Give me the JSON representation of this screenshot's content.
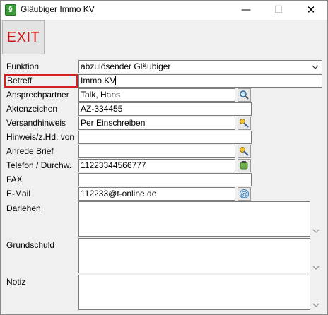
{
  "window": {
    "title": "Gläubiger Immo KV",
    "app_icon_glyph": "§",
    "minimize_glyph": "—",
    "maximize_glyph": "☐",
    "close_glyph": "✕"
  },
  "toolbar": {
    "exit_label": "EXIT",
    "exit_color": "#d41414"
  },
  "form": {
    "funktion": {
      "label": "Funktion",
      "value": "abzulösender Gläubiger"
    },
    "betreff": {
      "label": "Betreff",
      "value": "Immo KV"
    },
    "ansprechpartner": {
      "label": "Ansprechpartner",
      "value": "Talk, Hans",
      "button_icon": "search-icon"
    },
    "aktenzeichen": {
      "label": "Aktenzeichen",
      "value": "AZ-334455"
    },
    "versandhinweis": {
      "label": "Versandhinweis",
      "value": "Per Einschreiben",
      "button_icon": "key-icon"
    },
    "hinweis": {
      "label": "Hinweis/z.Hd. von",
      "value": ""
    },
    "anrede": {
      "label": "Anrede Brief",
      "value": "",
      "button_icon": "key-icon"
    },
    "telefon": {
      "label": "Telefon / Durchw.",
      "value": "11223344566777",
      "button_icon": "phone-icon"
    },
    "fax": {
      "label": "FAX",
      "value": ""
    },
    "email": {
      "label": "E-Mail",
      "value": "112233@t-online.de",
      "button_icon": "at-icon"
    },
    "darlehen": {
      "label": "Darlehen",
      "value": ""
    },
    "grundschuld": {
      "label": "Grundschuld",
      "value": ""
    },
    "notiz": {
      "label": "Notiz",
      "value": ""
    }
  },
  "colors": {
    "highlight_border": "#d32020"
  }
}
